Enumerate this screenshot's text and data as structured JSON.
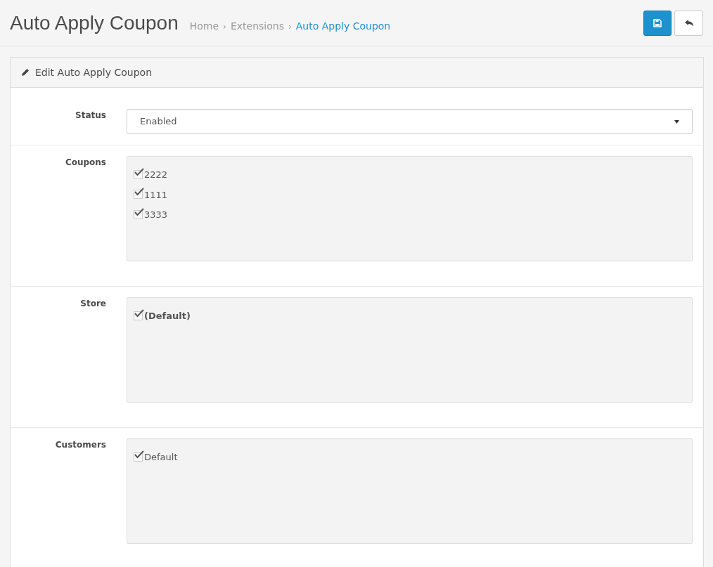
{
  "page_title": "Auto Apply Coupon",
  "breadcrumb": [
    {
      "label": "Home",
      "current": false
    },
    {
      "label": "Extensions",
      "current": false
    },
    {
      "label": "Auto Apply Coupon",
      "current": true
    }
  ],
  "breadcrumb_separator": "›",
  "panel": {
    "title": "Edit Auto Apply Coupon"
  },
  "fields": [
    {
      "kind": "select",
      "label": "Status",
      "value": "Enabled"
    },
    {
      "kind": "checklist",
      "label": "Coupons",
      "items": [
        {
          "label": "2222",
          "checked": true,
          "bold": false
        },
        {
          "label": "1111",
          "checked": true,
          "bold": false
        },
        {
          "label": "3333",
          "checked": true,
          "bold": false
        }
      ]
    },
    {
      "kind": "checklist",
      "label": "Store",
      "items": [
        {
          "label": "(Default)",
          "checked": true,
          "bold": true
        }
      ]
    },
    {
      "kind": "checklist",
      "label": "Customers",
      "items": [
        {
          "label": "Default",
          "checked": true,
          "bold": false
        }
      ]
    }
  ]
}
